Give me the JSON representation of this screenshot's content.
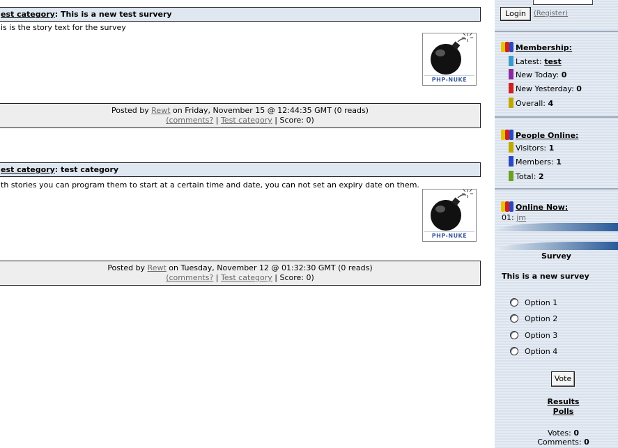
{
  "stories": [
    {
      "category": "est category",
      "title": ": This is a new test survery",
      "text": "is is the story text for the survey",
      "topic_caption": "PHP-NUKE",
      "posted_prefix": "Posted by ",
      "author": "Rewt",
      "posted_suffix": " on Friday, November 15 @ 12:44:35 GMT (0 reads)",
      "comments_link": "(comments?",
      "sep1": " | ",
      "category_link": "Test category",
      "score": " | Score: 0)"
    },
    {
      "category": "est category",
      "title": ": test category",
      "text": "th stories you can program them to start at a certain time and date, you can not set an expiry date on them.",
      "topic_caption": "PHP-NUKE",
      "posted_prefix": "Posted by ",
      "author": "Rewt",
      "posted_suffix": " on Tuesday, November 12 @ 01:32:30 GMT (0 reads)",
      "comments_link": "(comments?",
      "sep1": " | ",
      "category_link": "Test category",
      "score": " | Score: 0)"
    }
  ],
  "sidebar": {
    "login_button": "Login",
    "register_link": "(Register)",
    "membership": {
      "heading": "Membership:",
      "latest_label": "Latest: ",
      "latest_user": "test",
      "new_today_label": "New Today: ",
      "new_today": "0",
      "new_yesterday_label": "New Yesterday: ",
      "new_yesterday": "0",
      "overall_label": "Overall: ",
      "overall": "4"
    },
    "people_online": {
      "heading": "People Online:",
      "visitors_label": "Visitors: ",
      "visitors": "1",
      "members_label": "Members: ",
      "members": "1",
      "total_label": "Total: ",
      "total": "2"
    },
    "online_now": {
      "heading": "Online Now:",
      "entry_num": "01: ",
      "entry_user": "jm"
    },
    "survey": {
      "title": "Survey",
      "question": "This is a new survey",
      "options": [
        "Option 1",
        "Option 2",
        "Option 3",
        "Option 4"
      ],
      "vote_button": "Vote",
      "results_link": "Results",
      "polls_link": "Polls",
      "votes_label": "Votes: ",
      "votes": "0",
      "comments_label": "Comments: ",
      "comments": "0"
    }
  },
  "colors": {
    "title_bar": "#dfe7f1",
    "posted_bar": "#eeeeee",
    "sidebar_bg": "#e0e7f0",
    "accent_blue": "#2a5a9a"
  }
}
